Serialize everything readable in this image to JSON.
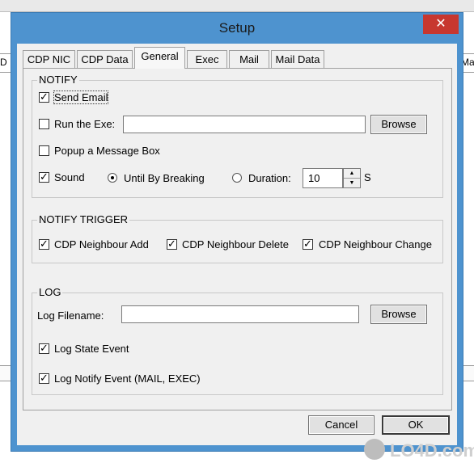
{
  "background": {
    "left_label": "D",
    "right_label": "Ma"
  },
  "dialog": {
    "title": "Setup",
    "close_glyph": "✕"
  },
  "tabs": [
    {
      "label": "CDP NIC"
    },
    {
      "label": "CDP Data"
    },
    {
      "label": "General"
    },
    {
      "label": "Exec"
    },
    {
      "label": "Mail"
    },
    {
      "label": "Mail Data"
    }
  ],
  "active_tab": "General",
  "notify": {
    "legend": "NOTIFY",
    "send_email": {
      "label": "Send Email",
      "checked": true
    },
    "run_exe": {
      "label": "Run the Exe:",
      "checked": false,
      "value": "",
      "browse_label": "Browse"
    },
    "popup": {
      "label": "Popup a Message Box",
      "checked": false
    },
    "sound": {
      "label": "Sound",
      "checked": true
    },
    "until_breaking": {
      "label": "Until By Breaking",
      "selected": true
    },
    "duration": {
      "label": "Duration:",
      "selected": false,
      "value": "10",
      "unit": "S"
    }
  },
  "notify_trigger": {
    "legend": "NOTIFY TRIGGER",
    "neighbour_add": {
      "label": "CDP Neighbour Add",
      "checked": true
    },
    "neighbour_delete": {
      "label": "CDP Neighbour Delete",
      "checked": true
    },
    "neighbour_change": {
      "label": "CDP Neighbour Change",
      "checked": true
    }
  },
  "log": {
    "legend": "LOG",
    "filename_label": "Log Filename:",
    "filename_value": "",
    "browse_label": "Browse",
    "state_event": {
      "label": "Log State Event",
      "checked": true
    },
    "notify_event": {
      "label": "Log Notify Event (MAIL, EXEC)",
      "checked": true
    }
  },
  "footer": {
    "cancel_label": "Cancel",
    "ok_label": "OK"
  },
  "watermark": "LO4D.com",
  "colors": {
    "titlebar": "#4e93cf",
    "close": "#c7372f",
    "panel": "#f0f0f0"
  }
}
